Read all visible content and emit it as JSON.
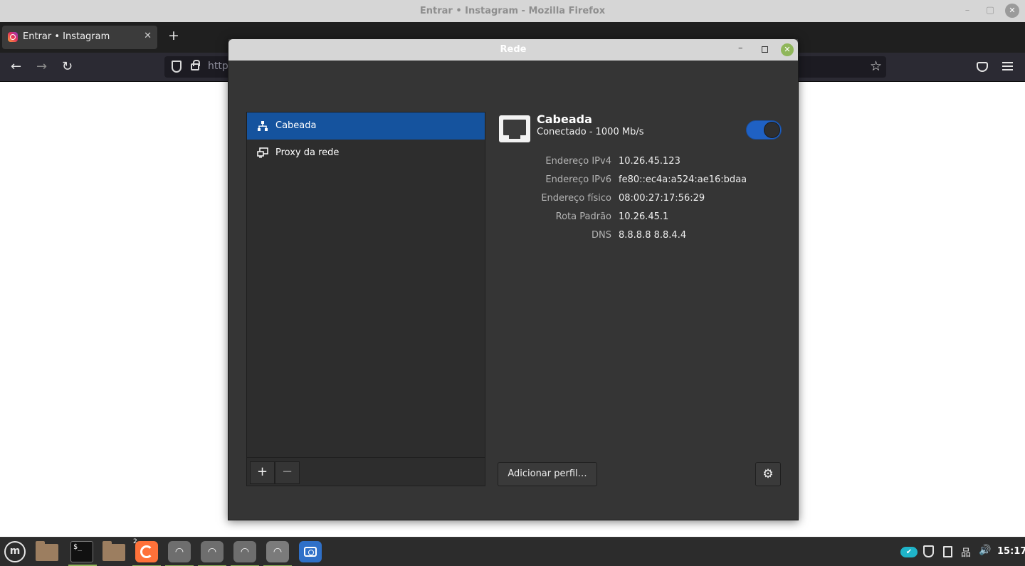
{
  "firefox": {
    "window_title": "Entrar • Instagram - Mozilla Firefox",
    "tab_title": "Entrar • Instagram",
    "tab_close": "✕",
    "new_tab": "+",
    "url_text": "http",
    "nav": {
      "back": "←",
      "forward": "→",
      "reload": "↻"
    },
    "star": "☆",
    "window_controls": {
      "minimize": "–",
      "maximize": "▢",
      "close": "✕"
    }
  },
  "network_dialog": {
    "title": "Rede",
    "close_symbol": "✕",
    "minimize_symbol": "–",
    "sidebar": {
      "items": [
        {
          "label": "Cabeada",
          "icon": "wired-network-icon",
          "active": true
        },
        {
          "label": "Proxy da rede",
          "icon": "proxy-icon",
          "active": false
        }
      ],
      "add_symbol": "+",
      "remove_symbol": "−"
    },
    "connection": {
      "name": "Cabeada",
      "status": "Conectado - 1000 Mb/s",
      "enabled": true
    },
    "details": [
      {
        "key": "Endereço IPv4",
        "value": "10.26.45.123"
      },
      {
        "key": "Endereço IPv6",
        "value": "fe80::ec4a:a524:ae16:bdaa"
      },
      {
        "key": "Endereço físico",
        "value": "08:00:27:17:56:29"
      },
      {
        "key": "Rota Padrão",
        "value": "10.26.45.1"
      },
      {
        "key": "DNS",
        "value": "8.8.8.8 8.8.4.4"
      }
    ],
    "add_profile_label": "Adicionar perfil…",
    "settings_symbol": "⚙"
  },
  "taskbar": {
    "mint_menu_letter": "m",
    "terminal_prompt": "$_",
    "firefox_badge": "2",
    "wifi_symbol": "◠",
    "clock": "15:17",
    "tray_cloud_symbol": "✔",
    "tray_network_symbol": "品",
    "tray_volume_symbol": "🔊"
  },
  "colors": {
    "accent": "#15539e",
    "toggle_on": "#1f61c4",
    "mint_green": "#8fb65a",
    "dialog_bg": "#353535"
  }
}
